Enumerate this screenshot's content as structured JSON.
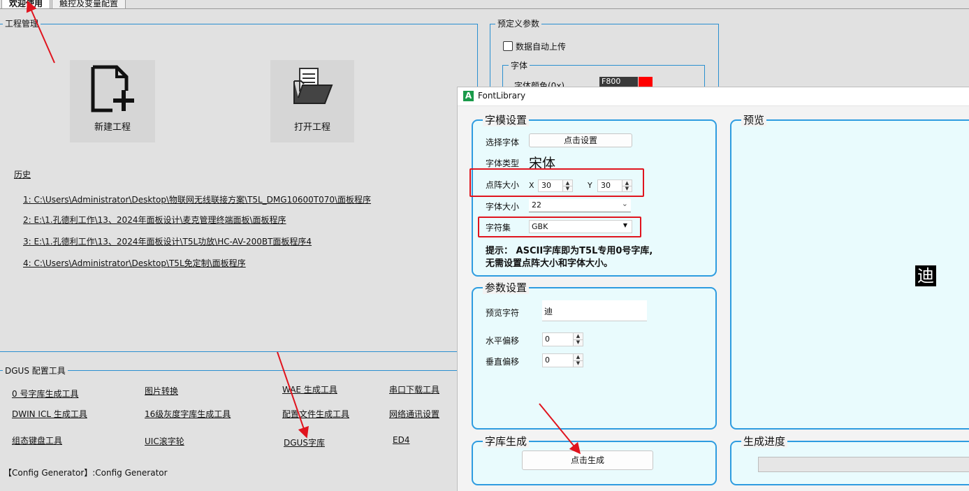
{
  "tabs": [
    "欢迎使用",
    "触控及变量配置"
  ],
  "project": {
    "title": "工程管理",
    "new_label": "新建工程",
    "open_label": "打开工程",
    "history_label": "历史",
    "history": [
      "1:  C:\\Users\\Administrator\\Desktop\\物联网无线联接方案\\T5L_DMG10600T070\\面板程序",
      "2:  E:\\1.孔德利工作\\13、2024年面板设计\\麦克管理终端面板\\面板程序",
      "3:  E:\\1.孔德利工作\\13、2024年面板设计\\T5L功放\\HC-AV-200BT面板程序4",
      "4:  C:\\Users\\Administrator\\Desktop\\T5L免定制\\面板程序"
    ]
  },
  "preset": {
    "title": "预定义参数",
    "auto_upload_label": "数据自动上传",
    "font_group": "字体",
    "font_color_label": "字体颜色(0x)",
    "font_color_value": "F800",
    "font_color_swatch": "#ff0000"
  },
  "dgus": {
    "title": "DGUS 配置工具",
    "tools": [
      "0 号字库生成工具",
      "图片转换",
      "WAE 生成工具",
      "串口下载工具",
      "DWIN ICL 生成工具",
      "16级灰度字库生成工具",
      "配置文件生成工具",
      "网络通讯设置",
      "组态键盘工具",
      "UIC滚字轮",
      "DGUS字库",
      "ED4"
    ],
    "footer": "【Config Generator】:Config Generator"
  },
  "fontlib": {
    "window_title": "FontLibrary",
    "app_icon": "A",
    "font_setup": {
      "title": "字模设置",
      "select_font_label": "选择字体",
      "select_font_button": "点击设置",
      "font_type_label": "字体类型",
      "font_type_value": "宋体",
      "dot_size_label": "点阵大小",
      "x_label": "X",
      "x_value": "30",
      "y_label": "Y",
      "y_value": "30",
      "font_size_label": "字体大小",
      "font_size_value": "22",
      "charset_label": "字符集",
      "charset_value": "GBK",
      "hint_line1": "提示： ASCII字库即为T5L专用0号字库,",
      "hint_line2": "无需设置点阵大小和字体大小。"
    },
    "preview": {
      "title": "预览",
      "char": "迪"
    },
    "params": {
      "title": "参数设置",
      "preview_char_label": "预览字符",
      "preview_char_value": "迪",
      "h_offset_label": "水平偏移",
      "h_offset_value": "0",
      "v_offset_label": "垂直偏移",
      "v_offset_value": "0"
    },
    "generate": {
      "title": "字库生成",
      "button": "点击生成"
    },
    "progress": {
      "title": "生成进度",
      "value": 0
    }
  },
  "colors": {
    "accent": "#2e9ce0",
    "panel_bg": "#e9fbfd",
    "highlight_red": "#e0141e"
  }
}
